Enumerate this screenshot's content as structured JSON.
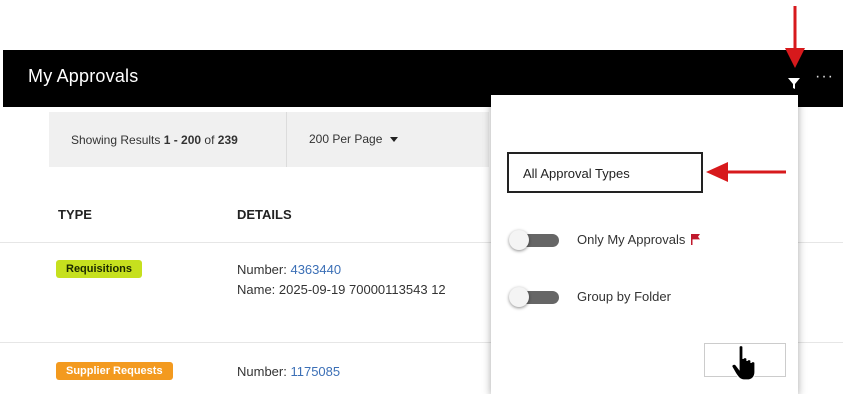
{
  "header": {
    "title": "My Approvals",
    "filter_icon": "filter-icon",
    "more_icon": "more-options-icon",
    "more_label": "···"
  },
  "results": {
    "showing_prefix": "Showing Results ",
    "range": "1 - 200",
    "of_label": " of ",
    "total": "239",
    "per_page": "200 Per Page"
  },
  "table": {
    "columns": [
      "TYPE",
      "DETAILS"
    ],
    "rows": [
      {
        "type": "Requisitions",
        "type_color": "#c6e01e",
        "number_label": "Number: ",
        "number": "4363440",
        "name_label": "Name: ",
        "name": "2025-09-19 70000113543 12"
      },
      {
        "type": "Supplier Requests",
        "type_color": "#f39a1f",
        "number_label": "Number: ",
        "number": "1175085"
      }
    ]
  },
  "filter_panel": {
    "approval_types": "All Approval Types",
    "toggles": [
      {
        "label": "Only My Approvals",
        "on": false,
        "icon": "red-flag-icon"
      },
      {
        "label": "Group by Folder",
        "on": false
      }
    ]
  },
  "colors": {
    "header_bg": "#000000",
    "annotation_red": "#d7191c",
    "link": "#3b6fb6"
  }
}
